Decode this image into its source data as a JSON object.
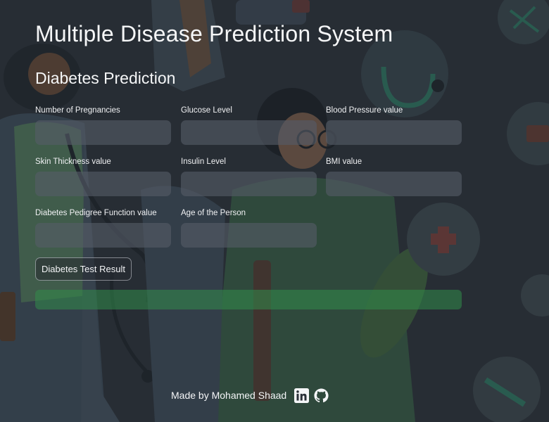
{
  "header": {
    "title": "Multiple Disease Prediction System"
  },
  "section": {
    "title": "Diabetes Prediction"
  },
  "form": {
    "fields": [
      {
        "label": "Number of Pregnancies",
        "value": "",
        "placeholder": ""
      },
      {
        "label": "Glucose Level",
        "value": "",
        "placeholder": ""
      },
      {
        "label": "Blood Pressure value",
        "value": "",
        "placeholder": ""
      },
      {
        "label": "Skin Thickness value",
        "value": "",
        "placeholder": ""
      },
      {
        "label": "Insulin Level",
        "value": "",
        "placeholder": ""
      },
      {
        "label": "BMI value",
        "value": "",
        "placeholder": ""
      },
      {
        "label": "Diabetes Pedigree Function value",
        "value": "",
        "placeholder": ""
      },
      {
        "label": "Age of the Person",
        "value": "",
        "placeholder": ""
      }
    ],
    "submit_label": "Diabetes Test Result"
  },
  "result": {
    "text": ""
  },
  "footer": {
    "credit": "Made by Mohamed Shaad",
    "icons": [
      "linkedin-icon",
      "github-icon"
    ]
  },
  "colors": {
    "background": "#2a3038",
    "input_bg": "#565c68",
    "result_success": "#318c4a",
    "text": "#f1f3f5"
  }
}
